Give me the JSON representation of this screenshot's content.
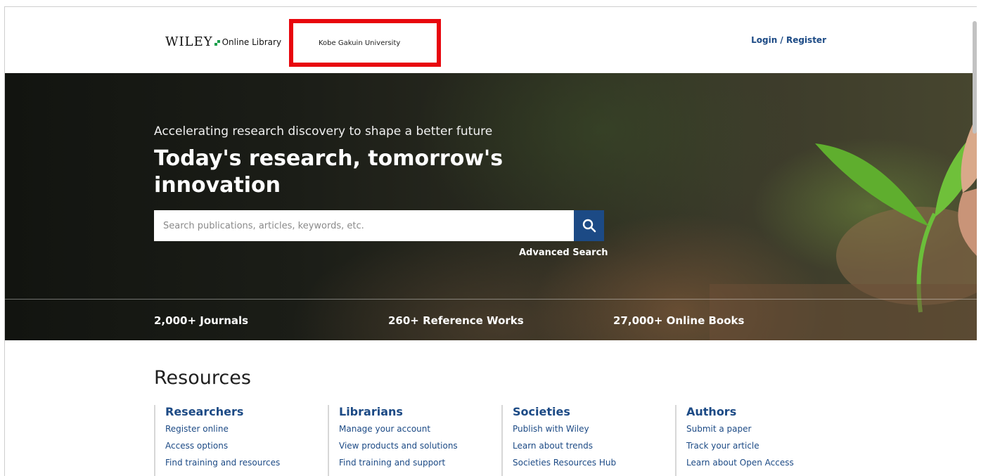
{
  "header": {
    "logo_wiley": "WILEY",
    "logo_library": "Online Library",
    "institution": "Kobe Gakuin University",
    "login": "Login / Register"
  },
  "hero": {
    "tagline": "Accelerating research discovery to shape a better future",
    "headline": "Today's research, tomorrow's innovation",
    "search_placeholder": "Search publications, articles, keywords, etc.",
    "advanced_search": "Advanced Search",
    "stats": [
      "2,000+ Journals",
      "260+ Reference Works",
      "27,000+ Online Books"
    ]
  },
  "resources": {
    "title": "Resources",
    "columns": [
      {
        "heading": "Researchers",
        "links": [
          "Register online",
          "Access options",
          "Find training and resources"
        ]
      },
      {
        "heading": "Librarians",
        "links": [
          "Manage your account",
          "View products and solutions",
          "Find training and support"
        ]
      },
      {
        "heading": "Societies",
        "links": [
          "Publish with Wiley",
          "Learn about trends",
          "Societies Resources Hub"
        ]
      },
      {
        "heading": "Authors",
        "links": [
          "Submit a paper",
          "Track your article",
          "Learn about Open Access"
        ]
      }
    ]
  },
  "colors": {
    "brand_blue": "#1c4a85",
    "highlight_red": "#e8070e",
    "logo_green": "#1b9e4b"
  },
  "icons": [
    "search-icon"
  ]
}
